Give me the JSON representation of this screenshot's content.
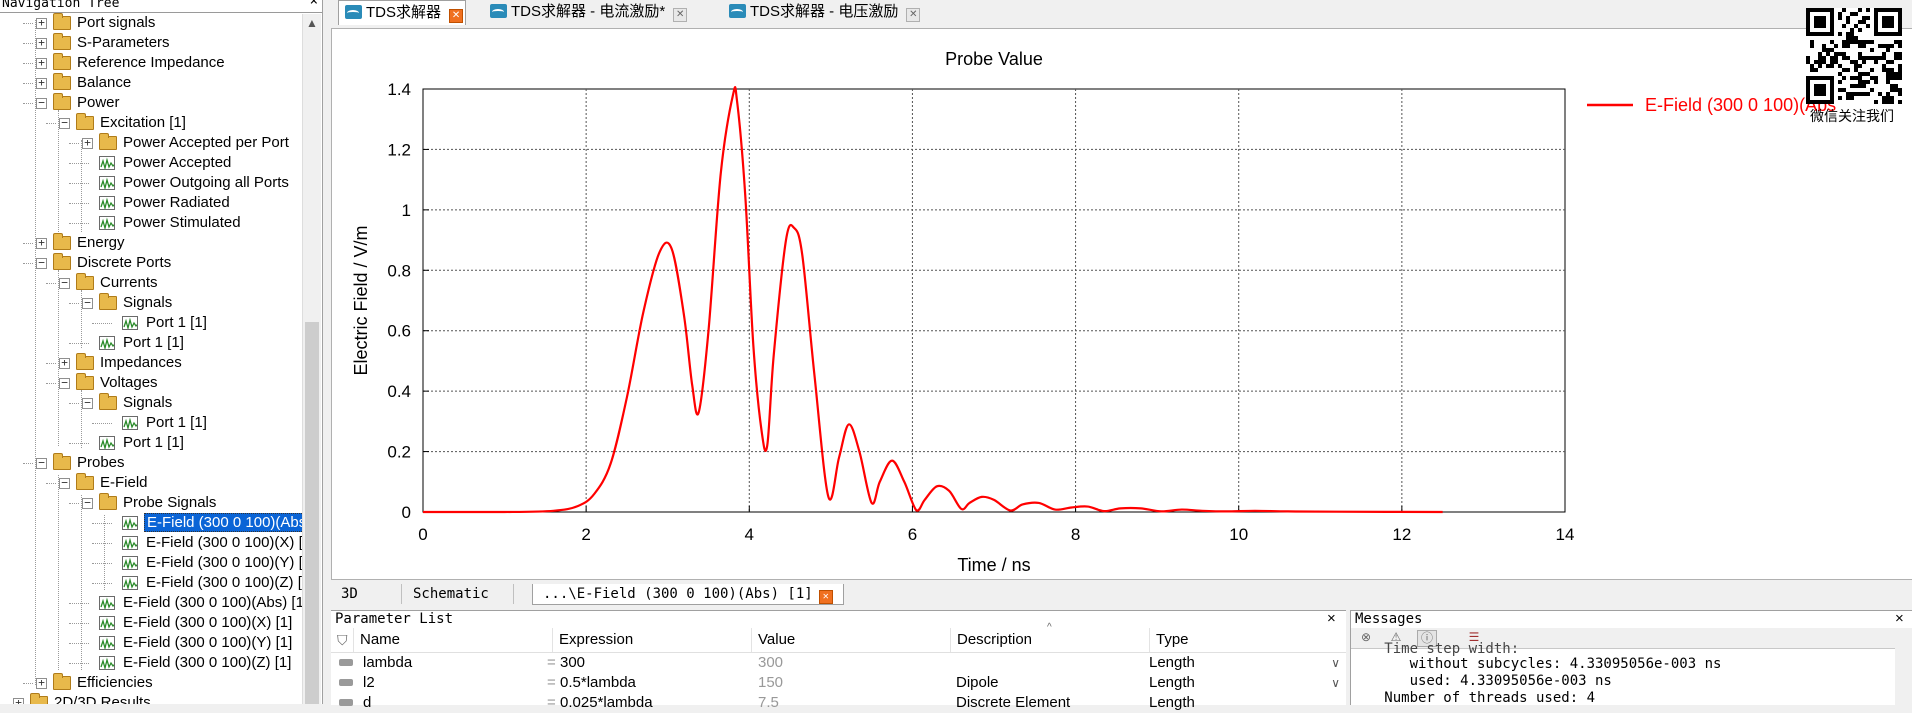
{
  "nav": {
    "title": "Navigation Tree",
    "close": "×",
    "items": [
      {
        "label": "Port signals",
        "level": 1,
        "icon": "folder",
        "exp": "+"
      },
      {
        "label": "S-Parameters",
        "level": 1,
        "icon": "folder",
        "exp": "+"
      },
      {
        "label": "Reference Impedance",
        "level": 1,
        "icon": "folder",
        "exp": "+"
      },
      {
        "label": "Balance",
        "level": 1,
        "icon": "folder",
        "exp": "+"
      },
      {
        "label": "Power",
        "level": 1,
        "icon": "folder",
        "exp": "-"
      },
      {
        "label": "Excitation [1]",
        "level": 2,
        "icon": "folder",
        "exp": "-"
      },
      {
        "label": "Power Accepted per Port",
        "level": 3,
        "icon": "folder",
        "exp": "+"
      },
      {
        "label": "Power Accepted",
        "level": 3,
        "icon": "signal",
        "exp": ""
      },
      {
        "label": "Power Outgoing all Ports",
        "level": 3,
        "icon": "signal",
        "exp": ""
      },
      {
        "label": "Power Radiated",
        "level": 3,
        "icon": "signal",
        "exp": ""
      },
      {
        "label": "Power Stimulated",
        "level": 3,
        "icon": "signal",
        "exp": ""
      },
      {
        "label": "Energy",
        "level": 1,
        "icon": "folder",
        "exp": "+"
      },
      {
        "label": "Discrete Ports",
        "level": 1,
        "icon": "folder",
        "exp": "-"
      },
      {
        "label": "Currents",
        "level": 2,
        "icon": "folder",
        "exp": "-"
      },
      {
        "label": "Signals",
        "level": 3,
        "icon": "folder",
        "exp": "-"
      },
      {
        "label": "Port 1 [1]",
        "level": 4,
        "icon": "signal",
        "exp": ""
      },
      {
        "label": "Port 1 [1]",
        "level": 3,
        "icon": "signal",
        "exp": ""
      },
      {
        "label": "Impedances",
        "level": 2,
        "icon": "folder",
        "exp": "+"
      },
      {
        "label": "Voltages",
        "level": 2,
        "icon": "folder",
        "exp": "-"
      },
      {
        "label": "Signals",
        "level": 3,
        "icon": "folder",
        "exp": "-"
      },
      {
        "label": "Port 1 [1]",
        "level": 4,
        "icon": "signal",
        "exp": ""
      },
      {
        "label": "Port 1 [1]",
        "level": 3,
        "icon": "signal",
        "exp": ""
      },
      {
        "label": "Probes",
        "level": 1,
        "icon": "folder",
        "exp": "-"
      },
      {
        "label": "E-Field",
        "level": 2,
        "icon": "folder",
        "exp": "-"
      },
      {
        "label": "Probe Signals",
        "level": 3,
        "icon": "folder",
        "exp": "-"
      },
      {
        "label": "E-Field (300 0 100)(Abs)",
        "level": 4,
        "icon": "signal",
        "exp": "",
        "selected": true
      },
      {
        "label": "E-Field (300 0 100)(X) [1",
        "level": 4,
        "icon": "signal",
        "exp": ""
      },
      {
        "label": "E-Field (300 0 100)(Y) [1",
        "level": 4,
        "icon": "signal",
        "exp": ""
      },
      {
        "label": "E-Field (300 0 100)(Z) [1",
        "level": 4,
        "icon": "signal",
        "exp": ""
      },
      {
        "label": "E-Field (300 0 100)(Abs) [1]",
        "level": 3,
        "icon": "signal",
        "exp": ""
      },
      {
        "label": "E-Field (300 0 100)(X) [1]",
        "level": 3,
        "icon": "signal",
        "exp": ""
      },
      {
        "label": "E-Field (300 0 100)(Y) [1]",
        "level": 3,
        "icon": "signal",
        "exp": ""
      },
      {
        "label": "E-Field (300 0 100)(Z) [1]",
        "level": 3,
        "icon": "signal",
        "exp": ""
      },
      {
        "label": "Efficiencies",
        "level": 1,
        "icon": "folder",
        "exp": "+"
      },
      {
        "label": "2D/3D Results",
        "level": 0,
        "icon": "folder",
        "exp": "+"
      }
    ]
  },
  "doc_tabs": [
    {
      "label": "TDS求解器",
      "active": true
    },
    {
      "label": "TDS求解器 - 电流激励*",
      "active": false
    },
    {
      "label": "TDS求解器 - 电压激励",
      "active": false
    }
  ],
  "chart_data": {
    "type": "line",
    "title": "Probe Value",
    "xlabel": "Time / ns",
    "ylabel": "Electric Field / V/m",
    "xlim": [
      0,
      14
    ],
    "ylim": [
      0,
      1.4
    ],
    "xticks": [
      0,
      2,
      4,
      6,
      8,
      10,
      12,
      14
    ],
    "yticks": [
      0,
      0.2,
      0.4,
      0.6,
      0.8,
      1,
      1.2,
      1.4
    ],
    "tick_labels_x": [
      "0",
      "2",
      "4",
      "6",
      "8",
      "10",
      "12",
      "14"
    ],
    "tick_labels_y": [
      "0",
      "0.2",
      "0.4",
      "0.6",
      "0.8",
      "1",
      "1.2",
      "1.4"
    ],
    "grid": true,
    "legend": "top-right",
    "series": [
      {
        "name": "E-Field (300 0 100)(Abs",
        "color": "#ff0000",
        "x": [
          0,
          1.0,
          1.6,
          1.9,
          2.1,
          2.3,
          2.5,
          2.7,
          2.9,
          3.05,
          3.2,
          3.3,
          3.38,
          3.5,
          3.65,
          3.8,
          3.85,
          3.95,
          4.05,
          4.15,
          4.22,
          4.3,
          4.45,
          4.55,
          4.65,
          4.8,
          4.97,
          5.1,
          5.22,
          5.35,
          5.5,
          5.6,
          5.75,
          5.9,
          6.05,
          6.15,
          6.3,
          6.45,
          6.6,
          6.7,
          6.85,
          7.0,
          7.2,
          7.35,
          7.55,
          7.75,
          7.95,
          8.15,
          8.35,
          8.55,
          8.8,
          9.05,
          9.3,
          9.55,
          9.85,
          10.2,
          10.6,
          11.2,
          12.5
        ],
        "y": [
          0,
          0,
          0.004,
          0.02,
          0.06,
          0.16,
          0.38,
          0.66,
          0.86,
          0.87,
          0.65,
          0.42,
          0.33,
          0.6,
          1.12,
          1.38,
          1.36,
          1.05,
          0.55,
          0.27,
          0.22,
          0.52,
          0.9,
          0.94,
          0.85,
          0.45,
          0.05,
          0.18,
          0.29,
          0.2,
          0.03,
          0.1,
          0.17,
          0.1,
          0.005,
          0.04,
          0.085,
          0.07,
          0.01,
          0.03,
          0.05,
          0.04,
          0.005,
          0.025,
          0.03,
          0.008,
          0.015,
          0.018,
          0.003,
          0.012,
          0.012,
          0.002,
          0.008,
          0.004,
          0.002,
          0.004,
          0.002,
          0.001,
          0
        ]
      }
    ]
  },
  "qr_caption": "微信关注我们",
  "view_tabs": [
    {
      "label": "3D",
      "active": false
    },
    {
      "label": "Schematic",
      "active": false
    },
    {
      "label": "...\\E-Field (300 0 100)(Abs) [1]",
      "active": true
    }
  ],
  "param": {
    "title": "Parameter List",
    "close": "×",
    "columns": [
      "Name",
      "Expression",
      "Value",
      "Description",
      "Type"
    ],
    "rows": [
      {
        "name": "lambda",
        "eq": "=",
        "expression": "300",
        "value": "300",
        "description": "",
        "type": "Length"
      },
      {
        "name": "l2",
        "eq": "=",
        "expression": "0.5*lambda",
        "value": "150",
        "description": "Dipole",
        "type": "Length"
      },
      {
        "name": "d",
        "eq": "=",
        "expression": "0.025*lambda",
        "value": "7.5",
        "description": "Discrete Element",
        "type": "Length"
      }
    ]
  },
  "messages": {
    "title": "Messages",
    "close": "×",
    "lines": [
      "   Time step width:",
      "      without subcycles: 4.33095056e-003 ns",
      "      used: 4.33095056e-003 ns",
      "   Number of threads used: 4"
    ]
  }
}
